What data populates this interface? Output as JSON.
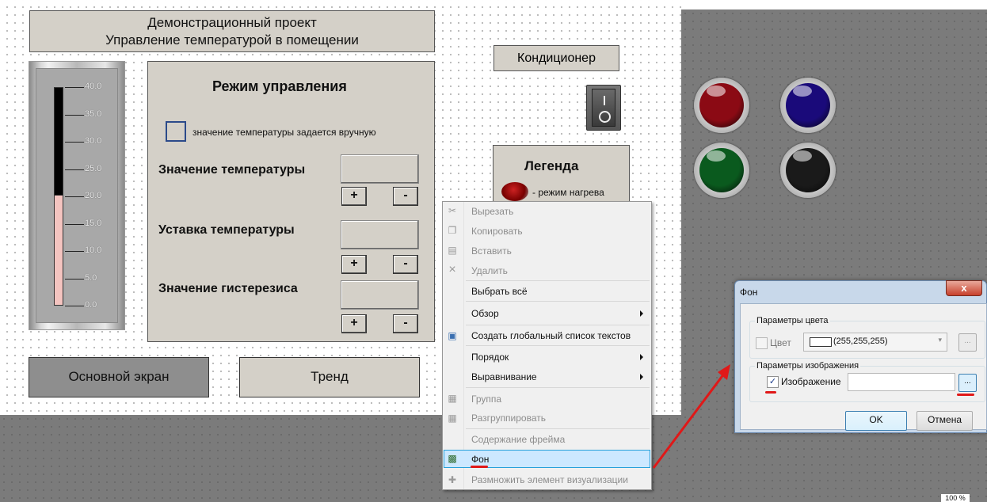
{
  "project_title": {
    "line1": "Демонстрационный проект",
    "line2": "Управление температурой в помещении"
  },
  "thermometer": {
    "ticks": [
      "40.0",
      "35.0",
      "30.0",
      "25.0",
      "20.0",
      "15.0",
      "10.0",
      "5.0",
      "0.0"
    ],
    "level_value": 19.5
  },
  "mode_panel": {
    "title": "Режим управления",
    "manual_checkbox_label": "значение температуры задается вручную",
    "temp_value_label": "Значение температуры",
    "setpoint_label": "Уставка температуры",
    "hysteresis_label": "Значение гистерезиса",
    "plus": "+",
    "minus": "-"
  },
  "nav": {
    "main_screen": "Основной экран",
    "trend": "Тренд"
  },
  "aircon": {
    "label": "Кондиционер"
  },
  "legend": {
    "title": "Легенда",
    "heating": "- режим нагрева"
  },
  "lamps": {
    "red": "#8b0a14",
    "blue": "#1a0a7a",
    "green": "#0a5a1e",
    "black": "#1a1a1a"
  },
  "context_menu": {
    "cut": "Вырезать",
    "copy": "Копировать",
    "paste": "Вставить",
    "delete": "Удалить",
    "select_all": "Выбрать всё",
    "browse": "Обзор",
    "create_global_text_list": "Создать глобальный список текстов",
    "order": "Порядок",
    "align": "Выравнивание",
    "group": "Группа",
    "ungroup": "Разгруппировать",
    "frame_content": "Содержание фрейма",
    "background": "Фон",
    "multiply_element": "Размножить элемент визуализации"
  },
  "dialog": {
    "title": "Фон",
    "close": "x",
    "color_group": "Параметры цвета",
    "color_label": "Цвет",
    "color_value": "(255,255,255)",
    "image_group": "Параметры изображения",
    "image_label": "Изображение",
    "image_value": "",
    "ellipsis": "...",
    "ok": "OK",
    "cancel": "Отмена"
  },
  "zoom": "100 %",
  "colors": {
    "highlight": "#cce8ff",
    "annotation_red": "#e01818",
    "canvas_gray": "#7b7b7b"
  }
}
